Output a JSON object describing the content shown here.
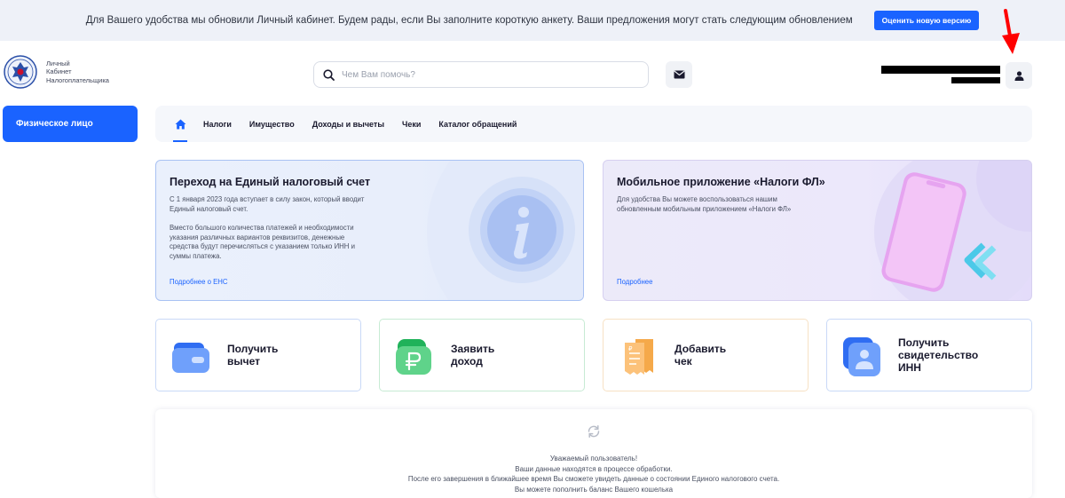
{
  "banner": {
    "text": "Для Вашего удобства мы обновили Личный кабинет. Будем рады, если Вы заполните короткую анкету. Ваши предложения могут стать следующим обновлением",
    "button": "Оценить новую версию"
  },
  "logo": {
    "line1": "Личный",
    "line2": "Кабинет",
    "line3": "Налогоплательщика"
  },
  "search": {
    "placeholder": "Чем Вам помочь?"
  },
  "sidebar": {
    "active_item": "Физическое лицо"
  },
  "nav": {
    "items": [
      {
        "label": "Налоги"
      },
      {
        "label": "Имущество"
      },
      {
        "label": "Доходы и вычеты"
      },
      {
        "label": "Чеки"
      },
      {
        "label": "Каталог обращений"
      }
    ]
  },
  "cards": {
    "ens": {
      "title": "Переход на Единый налоговый счет",
      "p1_l1": "С 1 января 2023 года вступает в силу закон, который вводит",
      "p1_l2": "Единый налоговый счет.",
      "p2_l1": "Вместо большого количества платежей и необходимости",
      "p2_l2": "указания различных вариантов реквизитов, денежные",
      "p2_l3": "средства будут перечисляться с указанием только ИНН и",
      "p2_l4": "суммы платежа.",
      "link": "Подробнее о ЕНС"
    },
    "app": {
      "title": "Мобильное приложение «Налоги ФЛ»",
      "l1": "Для удобства Вы можете воспользоваться нашим",
      "l2": "обновленным мобильным приложением «Налоги ФЛ»",
      "link": "Подробнее"
    }
  },
  "tiles": [
    {
      "l1": "Получить",
      "l2": "вычет",
      "l3": "",
      "border": "#c9d9f7"
    },
    {
      "l1": "Заявить",
      "l2": "доход",
      "l3": "",
      "border": "#c7ebd4"
    },
    {
      "l1": "Добавить",
      "l2": "чек",
      "l3": "",
      "border": "#f7e1c4"
    },
    {
      "l1": "Получить",
      "l2": "свидетельство",
      "l3": "ИНН",
      "border": "#c9d9f7"
    }
  ],
  "status": {
    "l1": "Уважаемый пользователь!",
    "l2": "Ваши данные находятся в процессе обработки.",
    "l3": "После его завершения в ближайшее время Вы сможете увидеть данные о состоянии Единого налогового счета.",
    "l4": "Вы можете пополнить баланс Вашего кошелька"
  },
  "icons": {
    "search": "search-icon",
    "mail": "mail-icon",
    "user": "user-icon",
    "home": "home-icon",
    "annotation": "red-arrow-icon"
  },
  "colors": {
    "accent": "#1a63ff",
    "annotation": "#ff0000"
  }
}
